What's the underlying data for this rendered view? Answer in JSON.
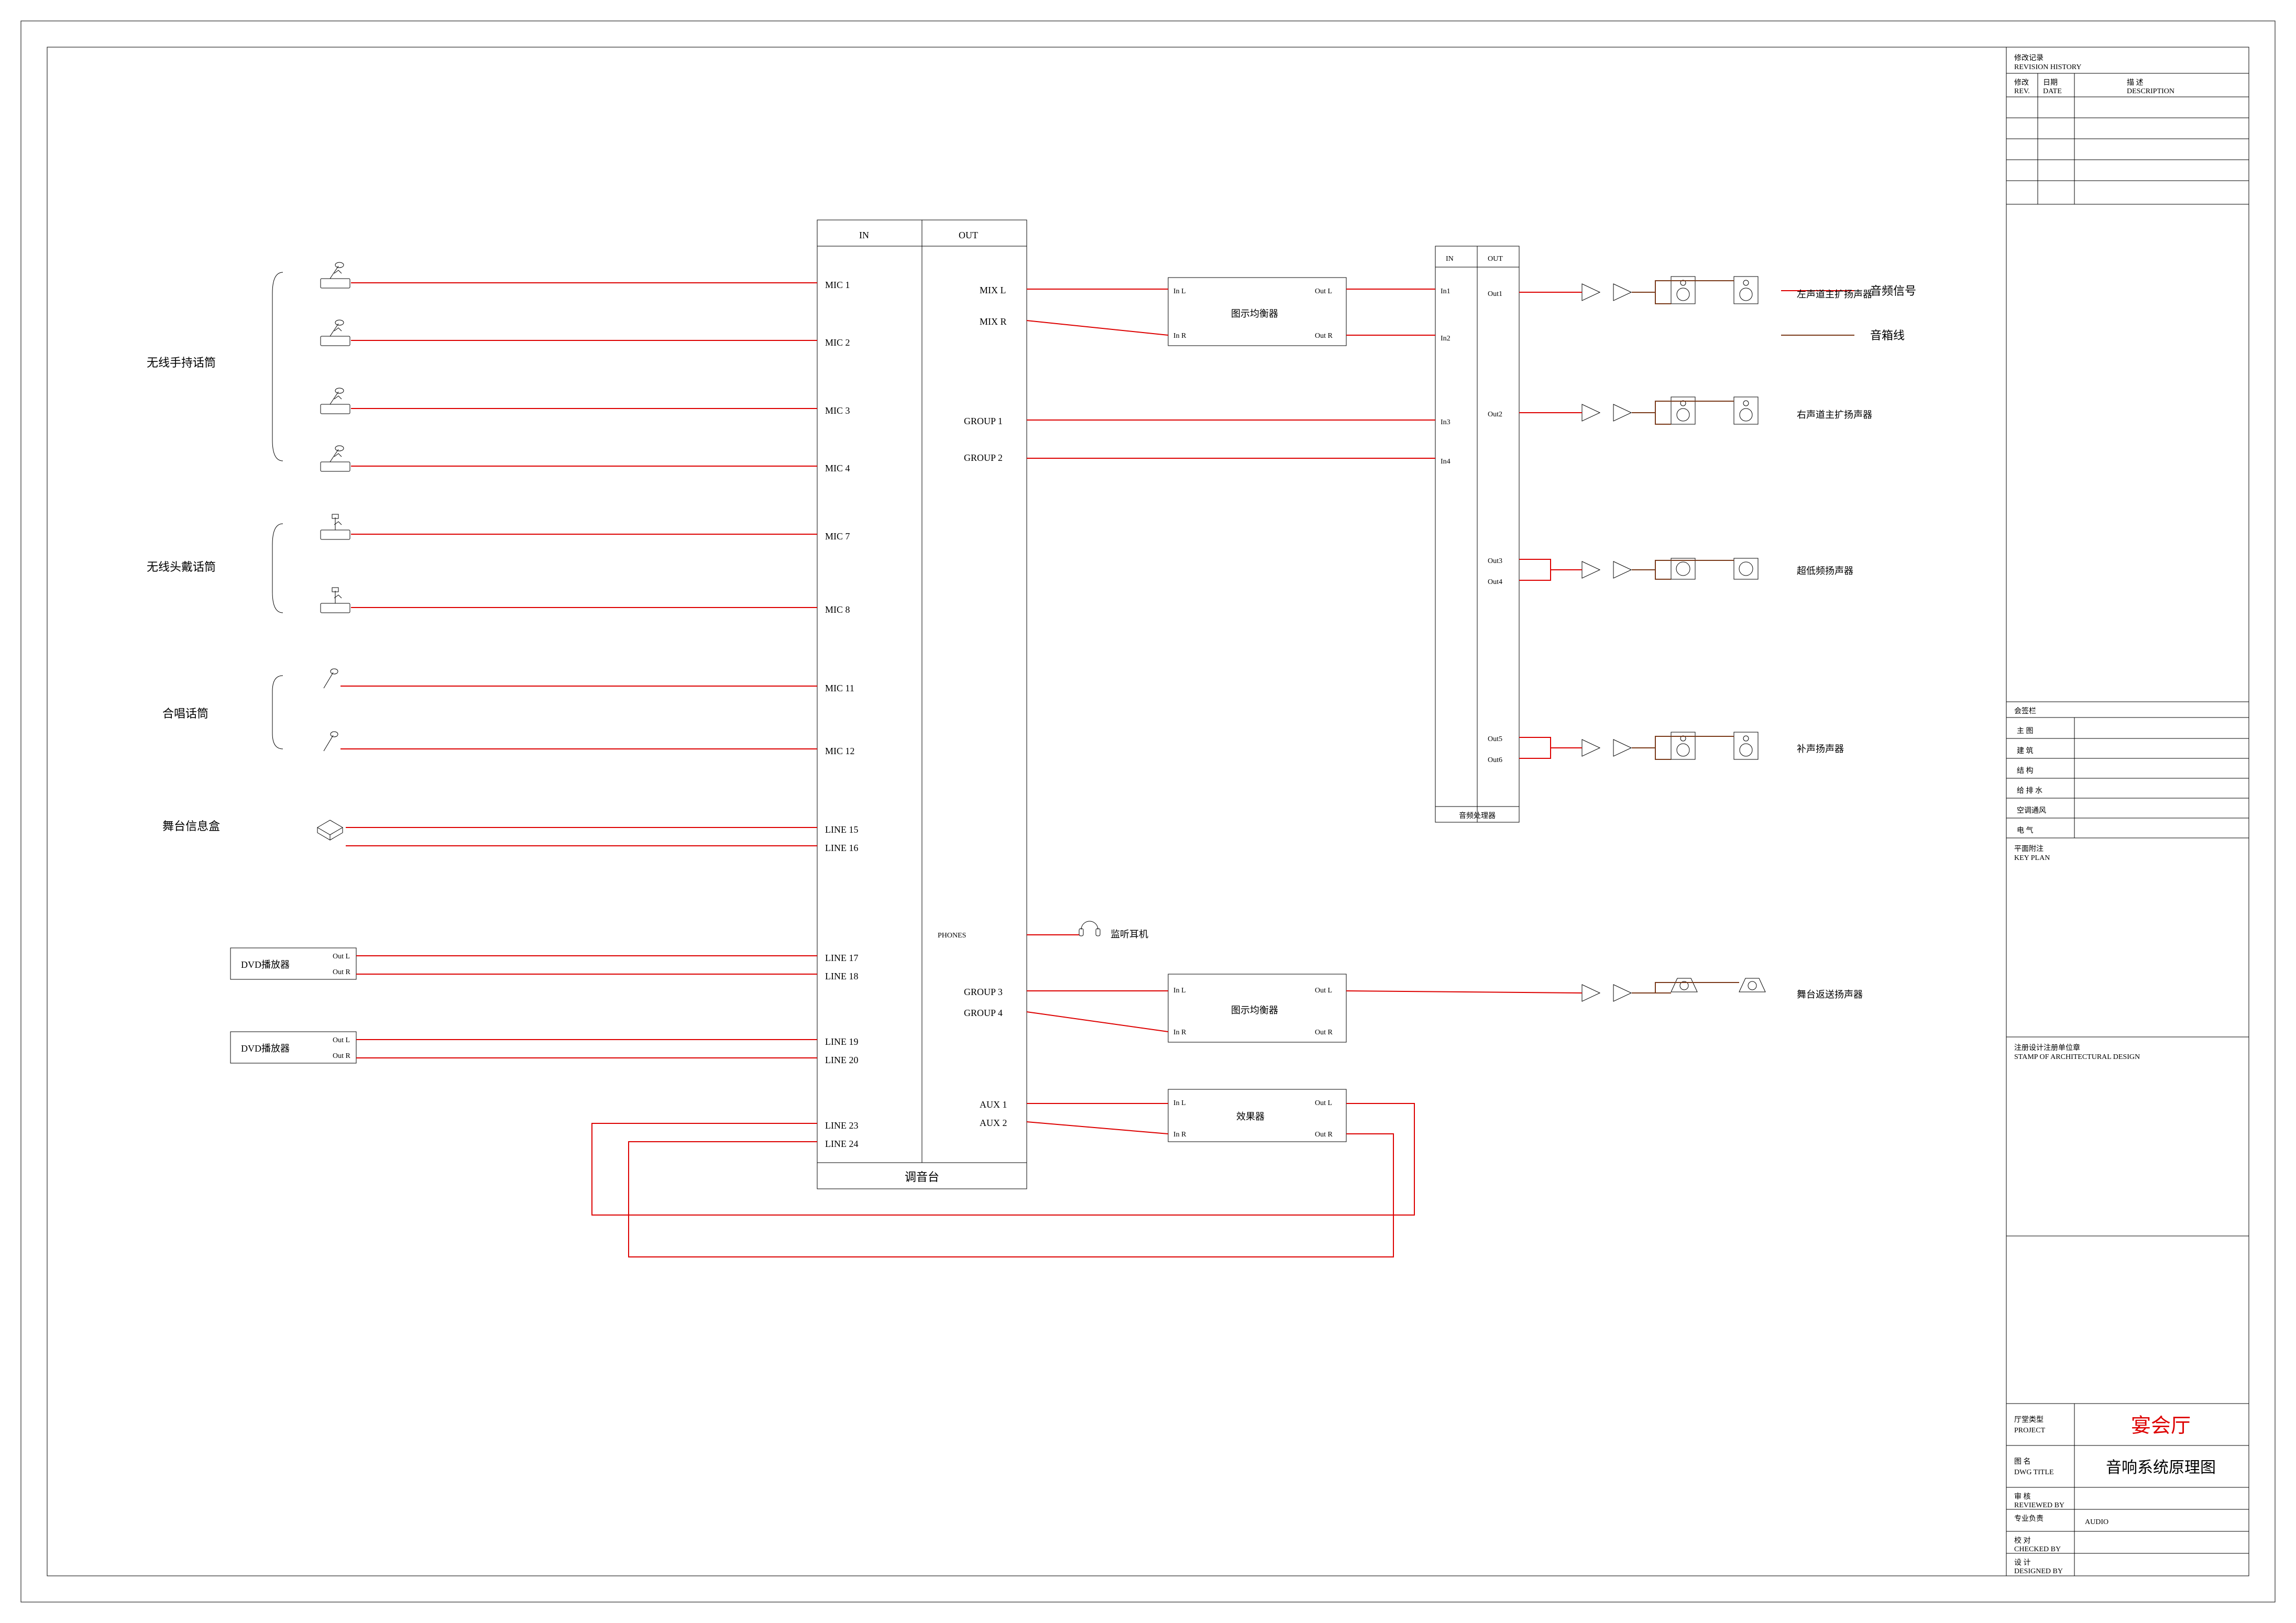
{
  "sources": {
    "wireless_hand_label": "无线手持话筒",
    "wireless_head_label": "无线头戴话筒",
    "choir_label": "合唱话筒",
    "stagebox_label": "舞台信息盒",
    "dvd1_label": "DVD播放器",
    "dvd2_label": "DVD播放器",
    "dvd_outL": "Out L",
    "dvd_outR": "Out R"
  },
  "mixer": {
    "label": "调音台",
    "header_in": "IN",
    "header_out": "OUT",
    "in": {
      "mic1": "MIC 1",
      "mic2": "MIC 2",
      "mic3": "MIC 3",
      "mic4": "MIC 4",
      "mic7": "MIC 7",
      "mic8": "MIC 8",
      "mic11": "MIC 11",
      "mic12": "MIC 12",
      "line15": "LINE 15",
      "line16": "LINE 16",
      "line17": "LINE 17",
      "line18": "LINE 18",
      "line19": "LINE 19",
      "line20": "LINE 20",
      "line23": "LINE 23",
      "line24": "LINE 24"
    },
    "out": {
      "mixL": "MIX L",
      "mixR": "MIX R",
      "grp1": "GROUP 1",
      "grp2": "GROUP 2",
      "grp3": "GROUP 3",
      "grp4": "GROUP 4",
      "aux1": "AUX 1",
      "aux2": "AUX 2",
      "phones": "PHONES"
    }
  },
  "eq": {
    "label": "图示均衡器",
    "inL": "In L",
    "inR": "In R",
    "outL": "Out L",
    "outR": "Out R"
  },
  "fx": {
    "label": "效果器",
    "inL": "In L",
    "inR": "In R",
    "outL": "Out L",
    "outR": "Out R"
  },
  "proc": {
    "label": "音频处理器",
    "header_in": "IN",
    "header_out": "OUT",
    "in1": "In1",
    "in2": "In2",
    "in3": "In3",
    "in4": "In4",
    "out1": "Out1",
    "out2": "Out2",
    "out3": "Out3",
    "out4": "Out4",
    "out5": "Out5",
    "out6": "Out6"
  },
  "headphone_label": "监听耳机",
  "dest": {
    "mainL": "左声道主扩扬声器",
    "mainR": "右声道主扩扬声器",
    "sub": "超低频扬声器",
    "fill": "补声扬声器",
    "monitor": "舞台返送扬声器"
  },
  "legend": {
    "audio": "音频信号",
    "speaker_line": "音箱线"
  },
  "revision": {
    "block_title": "修改记录",
    "block_title_en": "REVISION HISTORY",
    "col1": "修改",
    "col1b": "REV.",
    "col2": "日期",
    "col2b": "DATE",
    "col3": "描  述",
    "col3b": "DESCRIPTION"
  },
  "signbox": {
    "title": "会签栏",
    "r1": "主  图",
    "r2": "建  筑",
    "r3": "结  构",
    "r4": "给 排 水",
    "r5": "空调通风",
    "r6": "电  气"
  },
  "noteplan": {
    "label": "平面附注",
    "label_en": "KEY PLAN"
  },
  "stamp": {
    "label": "注册设计注册单位章",
    "label_en": "STAMP OF ARCHITECTURAL DESIGN"
  },
  "titleblock": {
    "project_k": "厅堂类型",
    "project_en": "PROJECT",
    "project_v": "宴会厅",
    "dwg_k": "图  名",
    "dwg_en": "DWG TITLE",
    "dwg_v": "音响系统原理图",
    "rev_k": "审 核",
    "rev_en": "REVIEWED BY",
    "prof_k": "专业负责",
    "prof_en": "",
    "prof_v": "AUDIO",
    "chk_k": "校 对",
    "chk_en": "CHECKED BY",
    "des_k": "设 计",
    "des_en": "DESIGNED BY"
  },
  "chart_data": {
    "type": "signal-flow-schematic",
    "nodes": [
      {
        "id": "mic_wh",
        "label": "无线手持话筒",
        "qty": 4
      },
      {
        "id": "mic_hd",
        "label": "无线头戴话筒",
        "qty": 2
      },
      {
        "id": "mic_ch",
        "label": "合唱话筒",
        "qty": 2
      },
      {
        "id": "stgbox",
        "label": "舞台信息盒",
        "qty": 1
      },
      {
        "id": "dvd1",
        "label": "DVD播放器",
        "outs": [
          "Out L",
          "Out R"
        ]
      },
      {
        "id": "dvd2",
        "label": "DVD播放器",
        "outs": [
          "Out L",
          "Out R"
        ]
      },
      {
        "id": "mixer",
        "label": "调音台",
        "inputs": [
          "MIC 1",
          "MIC 2",
          "MIC 3",
          "MIC 4",
          "MIC 7",
          "MIC 8",
          "MIC 11",
          "MIC 12",
          "LINE 15",
          "LINE 16",
          "LINE 17",
          "LINE 18",
          "LINE 19",
          "LINE 20",
          "LINE 23",
          "LINE 24"
        ],
        "outputs": [
          "MIX L",
          "MIX R",
          "GROUP 1",
          "GROUP 2",
          "GROUP 3",
          "GROUP 4",
          "AUX 1",
          "AUX 2",
          "PHONES"
        ]
      },
      {
        "id": "eq1",
        "label": "图示均衡器",
        "ins": [
          "In L",
          "In R"
        ],
        "outs": [
          "Out L",
          "Out R"
        ]
      },
      {
        "id": "eq2",
        "label": "图示均衡器",
        "ins": [
          "In L",
          "In R"
        ],
        "outs": [
          "Out L",
          "Out R"
        ]
      },
      {
        "id": "fx",
        "label": "效果器",
        "ins": [
          "In L",
          "In R"
        ],
        "outs": [
          "Out L",
          "Out R"
        ]
      },
      {
        "id": "proc",
        "label": "音频处理器",
        "ins": [
          "In1",
          "In2",
          "In3",
          "In4"
        ],
        "outs": [
          "Out1",
          "Out2",
          "Out3",
          "Out4",
          "Out5",
          "Out6"
        ]
      },
      {
        "id": "amp",
        "label": "功放",
        "qty": 5
      },
      {
        "id": "spk_mainL",
        "label": "左声道主扩扬声器",
        "qty": 2
      },
      {
        "id": "spk_mainR",
        "label": "右声道主扩扬声器",
        "qty": 2
      },
      {
        "id": "spk_sub",
        "label": "超低频扬声器",
        "qty": 2
      },
      {
        "id": "spk_fill",
        "label": "补声扬声器",
        "qty": 2
      },
      {
        "id": "spk_mon",
        "label": "舞台返送扬声器",
        "qty": 2
      },
      {
        "id": "phones",
        "label": "监听耳机",
        "qty": 1
      }
    ],
    "edges": [
      {
        "from": "mic_wh",
        "to": "mixer",
        "ports": [
          "MIC 1",
          "MIC 2",
          "MIC 3",
          "MIC 4"
        ],
        "type": "audio"
      },
      {
        "from": "mic_hd",
        "to": "mixer",
        "ports": [
          "MIC 7",
          "MIC 8"
        ],
        "type": "audio"
      },
      {
        "from": "mic_ch",
        "to": "mixer",
        "ports": [
          "MIC 11",
          "MIC 12"
        ],
        "type": "audio"
      },
      {
        "from": "stgbox",
        "to": "mixer",
        "ports": [
          "LINE 15",
          "LINE 16"
        ],
        "type": "audio"
      },
      {
        "from": "dvd1",
        "to": "mixer",
        "ports": [
          "LINE 17",
          "LINE 18"
        ],
        "type": "audio"
      },
      {
        "from": "dvd2",
        "to": "mixer",
        "ports": [
          "LINE 19",
          "LINE 20"
        ],
        "type": "audio"
      },
      {
        "from": "mixer",
        "port_out": "MIX L",
        "to": "eq1",
        "port_in": "In L",
        "type": "audio"
      },
      {
        "from": "mixer",
        "port_out": "MIX R",
        "to": "eq1",
        "port_in": "In R",
        "type": "audio"
      },
      {
        "from": "eq1",
        "port_out": "Out L",
        "to": "proc",
        "port_in": "In1",
        "type": "audio"
      },
      {
        "from": "eq1",
        "port_out": "Out R",
        "to": "proc",
        "port_in": "In2",
        "type": "audio"
      },
      {
        "from": "mixer",
        "port_out": "GROUP 1",
        "to": "proc",
        "port_in": "In3",
        "type": "audio"
      },
      {
        "from": "mixer",
        "port_out": "GROUP 2",
        "to": "proc",
        "port_in": "In4",
        "type": "audio"
      },
      {
        "from": "mixer",
        "port_out": "GROUP 3",
        "to": "eq2",
        "port_in": "In L",
        "type": "audio"
      },
      {
        "from": "mixer",
        "port_out": "GROUP 4",
        "to": "eq2",
        "port_in": "In R",
        "type": "audio"
      },
      {
        "from": "mixer",
        "port_out": "AUX 1",
        "to": "fx",
        "port_in": "In L",
        "type": "audio"
      },
      {
        "from": "mixer",
        "port_out": "AUX 2",
        "to": "fx",
        "port_in": "In R",
        "type": "audio"
      },
      {
        "from": "fx",
        "port_out": "Out L",
        "to": "mixer",
        "port_in": "LINE 23",
        "type": "audio"
      },
      {
        "from": "fx",
        "port_out": "Out R",
        "to": "mixer",
        "port_in": "LINE 24",
        "type": "audio"
      },
      {
        "from": "mixer",
        "port_out": "PHONES",
        "to": "phones",
        "type": "audio"
      },
      {
        "from": "proc",
        "port_out": "Out1",
        "to": "spk_mainL",
        "via": "amp",
        "type": "audio+speaker"
      },
      {
        "from": "proc",
        "port_out": "Out2",
        "to": "spk_mainR",
        "via": "amp",
        "type": "audio+speaker"
      },
      {
        "from": "proc",
        "port_out": "Out3",
        "to": "spk_sub",
        "via": "amp",
        "type": "audio+speaker"
      },
      {
        "from": "proc",
        "port_out": "Out4",
        "to": "spk_sub",
        "via": "amp",
        "type": "audio+speaker"
      },
      {
        "from": "proc",
        "port_out": "Out5",
        "to": "spk_fill",
        "via": "amp",
        "type": "audio+speaker"
      },
      {
        "from": "proc",
        "port_out": "Out6",
        "to": "spk_fill",
        "via": "amp",
        "type": "audio+speaker"
      },
      {
        "from": "eq2",
        "port_out": "Out L",
        "to": "spk_mon",
        "via": "amp",
        "type": "audio+speaker"
      }
    ],
    "legend": {
      "audio": "红色线 = 音频信号",
      "speaker": "棕色线 = 音箱线"
    }
  }
}
